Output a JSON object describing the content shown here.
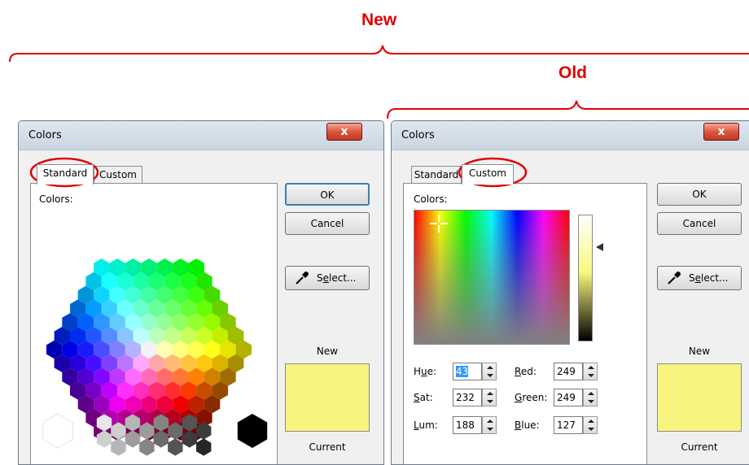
{
  "annotations": {
    "new_label": "New",
    "old_label": "Old",
    "color": "#e00000"
  },
  "new_dialog": {
    "title": "Colors",
    "close_glyph": "x",
    "tabs": [
      {
        "label": "Standard",
        "active": true
      },
      {
        "label": "Custom",
        "active": false
      }
    ],
    "colors_label": "Colors:",
    "buttons": {
      "ok": "OK",
      "cancel": "Cancel",
      "select_pre": "S",
      "select_ul": "e",
      "select_post": "lect..."
    },
    "new_caption": "New",
    "current_caption": "Current",
    "swatch_color": "#f7f47f",
    "icons": [
      "eyedropper-icon",
      "close-icon"
    ]
  },
  "old_dialog": {
    "title": "Colors",
    "close_glyph": "x",
    "tabs": [
      {
        "label": "Standard",
        "active": false
      },
      {
        "label": "Custom",
        "active": true
      }
    ],
    "colors_label": "Colors:",
    "buttons": {
      "ok": "OK",
      "cancel": "Cancel",
      "select_pre": "S",
      "select_ul": "e",
      "select_post": "lect..."
    },
    "fields": {
      "hue": {
        "pre": "H",
        "ul": "u",
        "post": "e:",
        "value": "43"
      },
      "sat": {
        "pre": "",
        "ul": "S",
        "post": "at:",
        "value": "232"
      },
      "lum": {
        "pre": "",
        "ul": "L",
        "post": "um:",
        "value": "188"
      },
      "red": {
        "pre": "",
        "ul": "R",
        "post": "ed:",
        "value": "249"
      },
      "green": {
        "pre": "",
        "ul": "G",
        "post": "reen:",
        "value": "249"
      },
      "blue": {
        "pre": "",
        "ul": "B",
        "post": "lue:",
        "value": "127"
      }
    },
    "new_caption": "New",
    "current_caption": "Current",
    "swatch_color": "#f7f47f"
  }
}
